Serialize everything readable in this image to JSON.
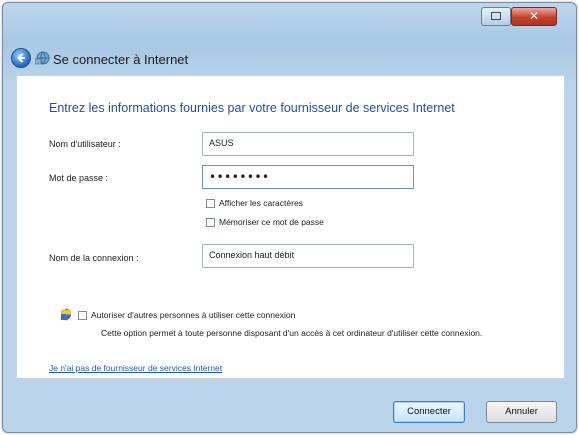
{
  "window": {
    "close_glyph": "✕"
  },
  "nav": {
    "title": "Se connecter à Internet",
    "back_icon": "back-arrow-icon",
    "network_icon": "network-icon"
  },
  "form": {
    "heading": "Entrez les informations fournies par votre fournisseur de services Internet",
    "username_label": "Nom d'utilisateur :",
    "username_value": "ASUS",
    "password_label": "Mot de passe :",
    "password_value": "••••••••",
    "show_chars_label": "Afficher les caractères",
    "remember_label": "Mémoriser ce mot de passe",
    "connection_label": "Nom de la connexion :",
    "connection_value": "Connexion haut débit",
    "allow_label": "Autoriser d'autres personnes à utiliser cette connexion",
    "allow_desc": "Cette option permet à toute personne disposant d'un accès à cet ordinateur d'utiliser cette connexion.",
    "no_isp_link": "Je n'ai pas de fournisseur de services Internet"
  },
  "buttons": {
    "connect": "Connecter",
    "cancel": "Annuler"
  },
  "colors": {
    "heading": "#1f4f9e",
    "link": "#1a5bbf",
    "titlebar": "#a9c8e4"
  }
}
